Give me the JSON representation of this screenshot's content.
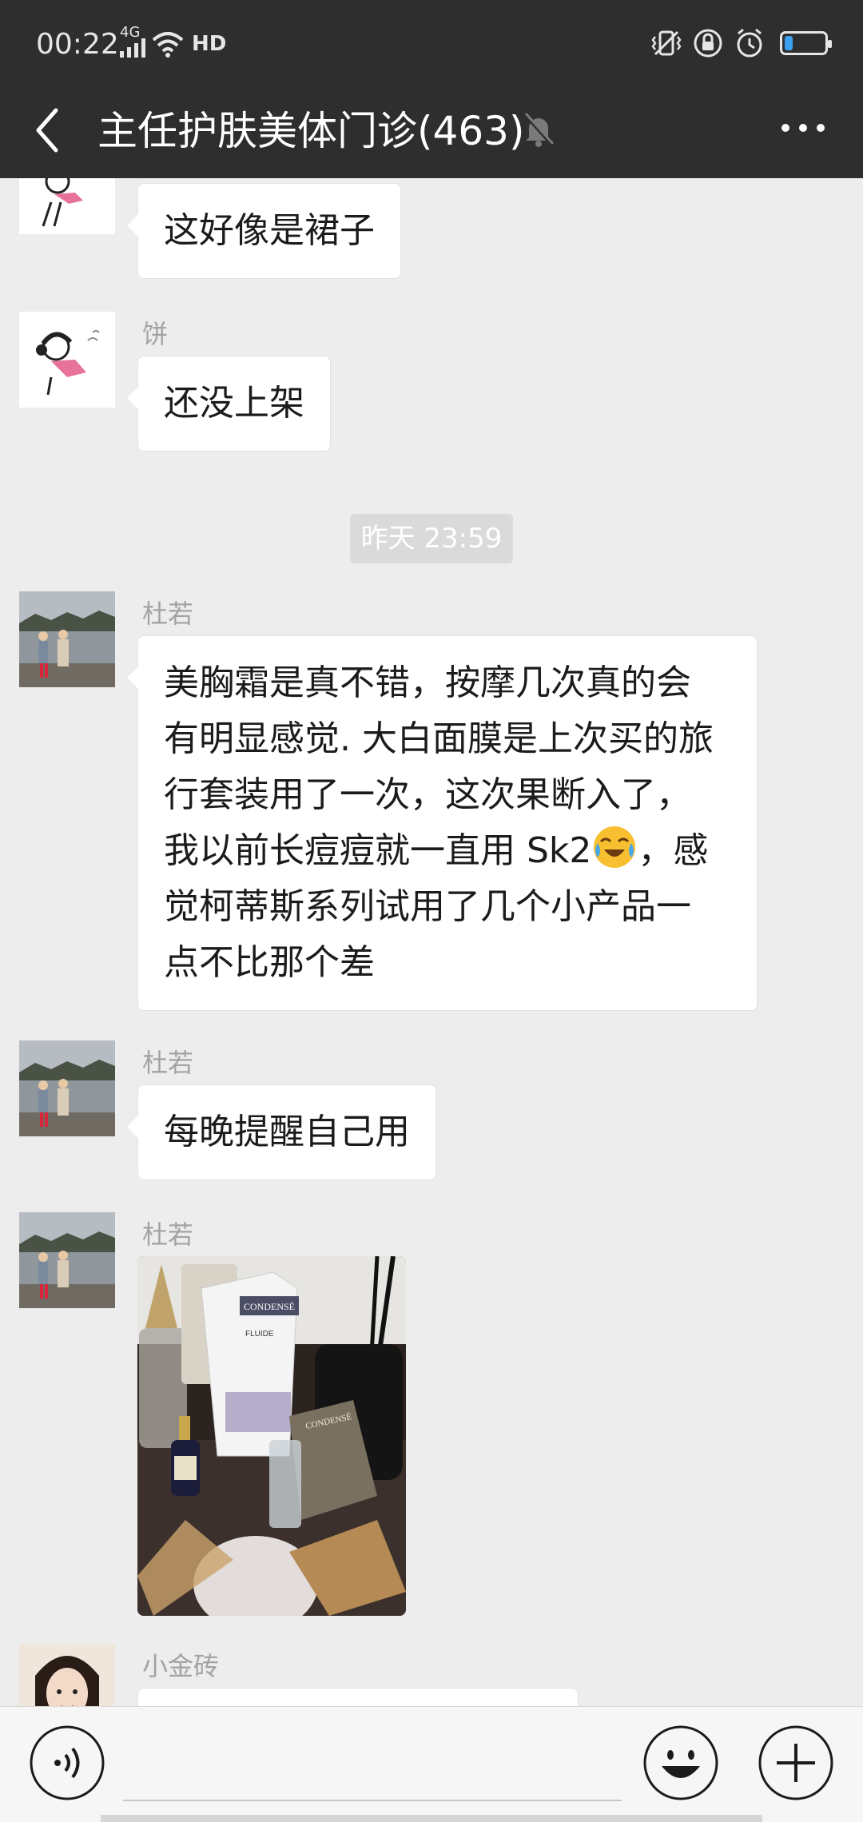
{
  "status_bar": {
    "time": "00:22",
    "network": "4G",
    "hd": "HD",
    "battery_level": 0.2,
    "icons": [
      "signal-icon",
      "wifi-icon",
      "vibrate-icon",
      "lock-rotation-icon",
      "alarm-icon",
      "battery-icon"
    ]
  },
  "header": {
    "title": "主任护肤美体门诊(463)",
    "icons": [
      "back-arrow-icon",
      "mute-bell-icon",
      "more-dots-icon"
    ]
  },
  "messages": [
    {
      "type": "text",
      "sender": "",
      "text": "这好像是裙子"
    },
    {
      "type": "text",
      "sender": "饼",
      "text": "还没上架"
    },
    {
      "type": "time",
      "text": "昨天 23:59"
    },
    {
      "type": "text",
      "sender": "杜若",
      "lines": [
        "美胸霜是真不错，按摩几次真的会",
        "有明显感觉. 大白面膜是上次买的旅",
        "行套装用了一次，这次果断入了，",
        "我以前长痘痘就一直用 Sk2",
        "，感",
        "觉柯蒂斯系列试用了几个小产品一",
        "点不比那个差"
      ]
    },
    {
      "type": "text",
      "sender": "杜若",
      "text": "每晚提醒自己用"
    },
    {
      "type": "image",
      "sender": "杜若",
      "image_labels": [
        "CONDENSÉ",
        "FLUIDE",
        "CONDENSÉ"
      ]
    },
    {
      "type": "text",
      "sender": "小金砖",
      "text": ""
    }
  ],
  "input_bar": {
    "icons": [
      "voice-icon",
      "emoji-icon",
      "plus-icon"
    ]
  },
  "colors": {
    "header_bg": "#2e2e2e",
    "chat_bg": "#ededed",
    "bubble_bg": "#ffffff",
    "timestamp_bg": "#dadada",
    "sender_text": "#a3a3a3"
  }
}
